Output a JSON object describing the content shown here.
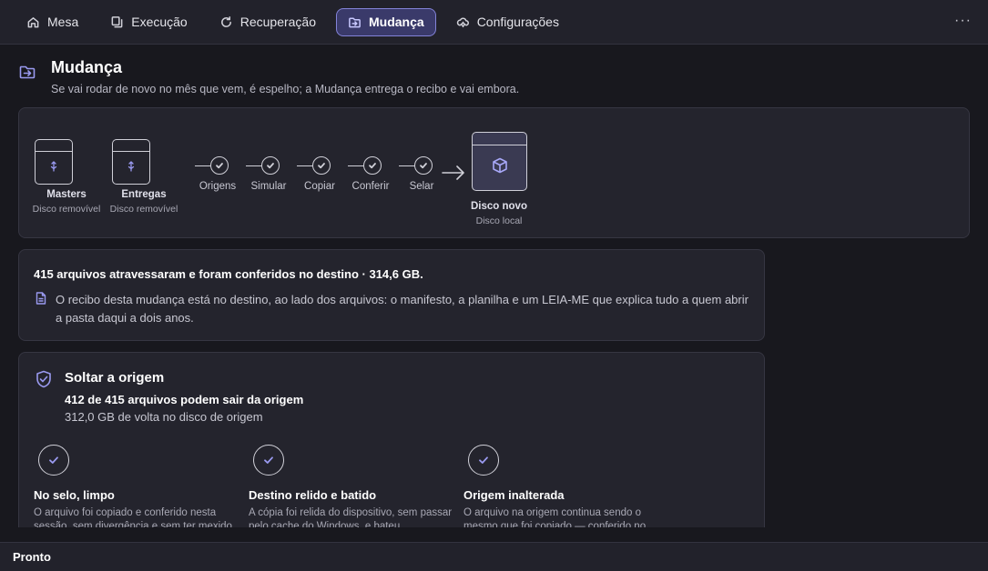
{
  "nav": {
    "tabs": [
      {
        "label": "Mesa",
        "icon": "home-icon"
      },
      {
        "label": "Execução",
        "icon": "copy-icon"
      },
      {
        "label": "Recuperação",
        "icon": "refresh-icon"
      },
      {
        "label": "Mudança",
        "icon": "folder-move-icon",
        "active": true
      },
      {
        "label": "Configurações",
        "icon": "cloud-gear-icon"
      }
    ],
    "more_label": "···"
  },
  "header": {
    "title": "Mudança",
    "subtitle": "Se vai rodar de novo no mês que vem, é espelho; a Mudança entrega o recibo e vai embora."
  },
  "flow": {
    "sources": [
      {
        "name": "Masters",
        "type": "Disco removível"
      },
      {
        "name": "Entregas",
        "type": "Disco removível"
      }
    ],
    "steps": [
      "Origens",
      "Simular",
      "Copiar",
      "Conferir",
      "Selar"
    ],
    "destination": {
      "name": "Disco novo",
      "type": "Disco local"
    }
  },
  "result": {
    "title": "415 arquivos atravessaram e foram conferidos no destino · 314,6 GB.",
    "text": "O recibo desta mudança está no destino, ao lado dos arquivos: o manifesto, a planilha e um LEIA-ME que explica tudo a quem abrir a pasta daqui a dois anos."
  },
  "release": {
    "title": "Soltar a origem",
    "count": "412 de 415 arquivos podem sair da origem",
    "size": "312,0 GB de volta no disco de origem",
    "checks": [
      {
        "title": "No selo, limpo",
        "desc": "O arquivo foi copiado e conferido nesta sessão, sem divergência e sem ter mexido"
      },
      {
        "title": "Destino relido e batido",
        "desc": "A cópia foi relida do dispositivo, sem passar pelo cache do Windows, e bateu"
      },
      {
        "title": "Origem inalterada",
        "desc": "O arquivo na origem continua sendo o mesmo que foi copiado — conferido no"
      }
    ]
  },
  "status": {
    "text": "Pronto"
  },
  "colors": {
    "accent": "#8383d8",
    "background": "#18181e",
    "card": "#24242d"
  }
}
